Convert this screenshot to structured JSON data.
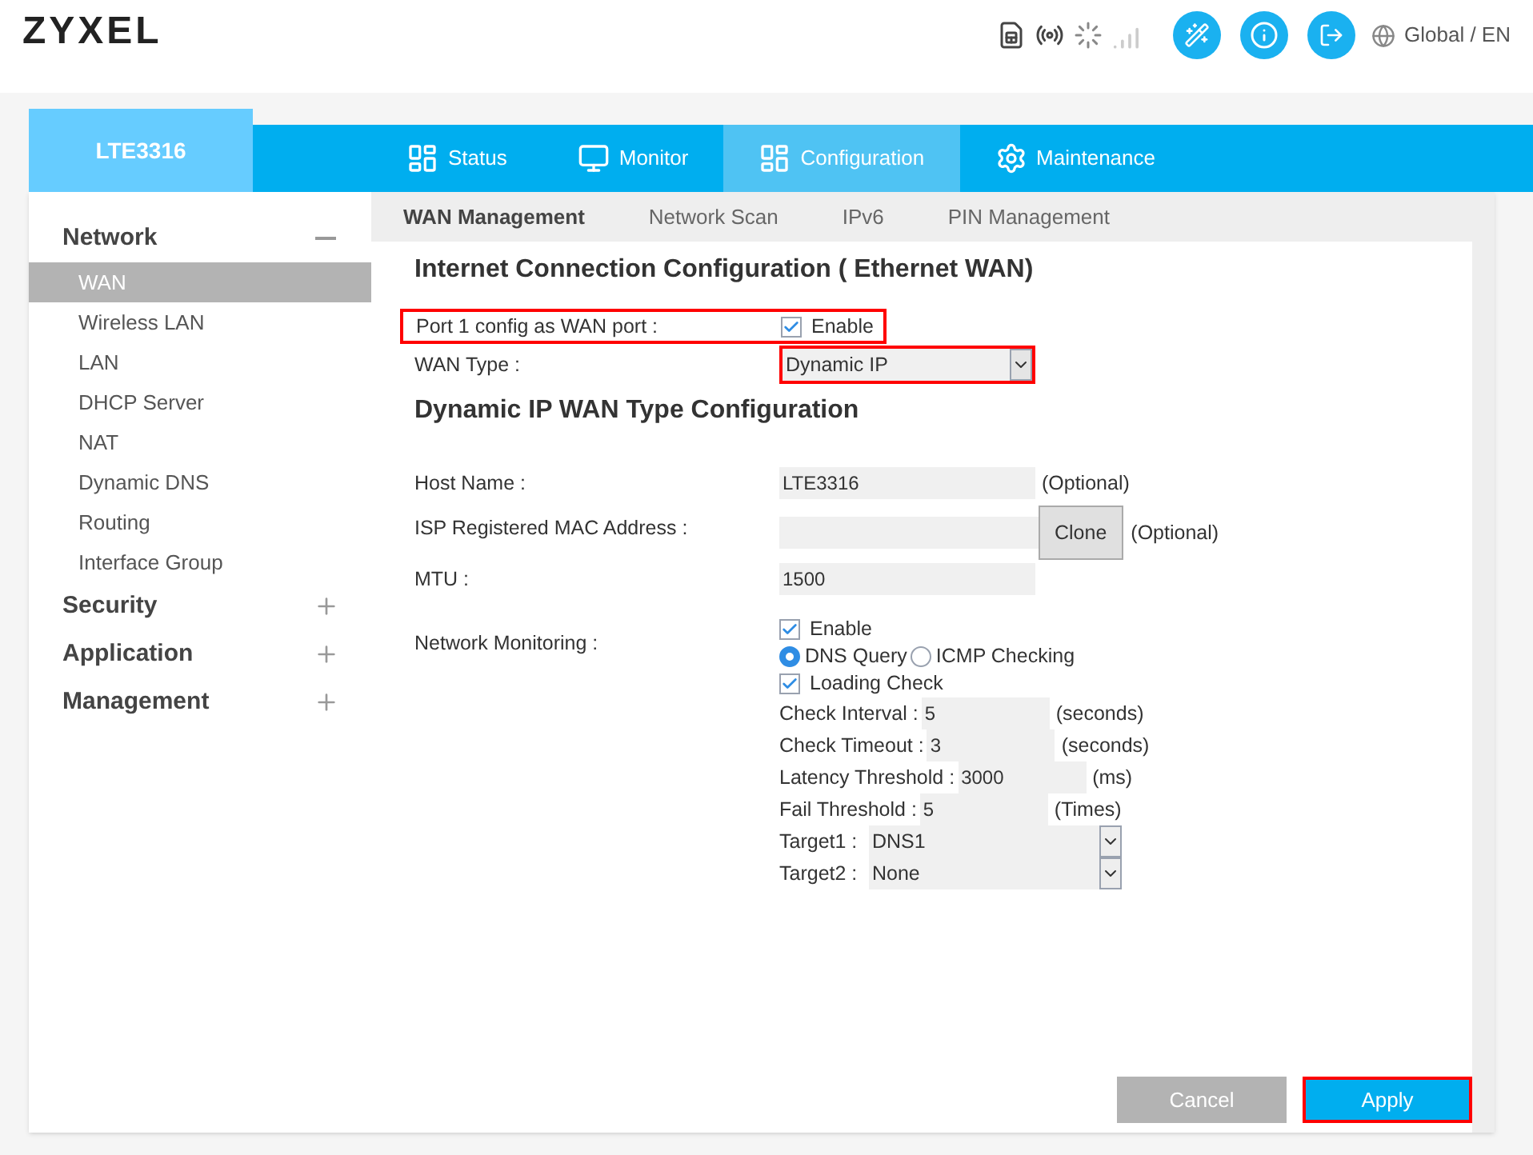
{
  "header": {
    "logo": "ZYXEL",
    "language": "Global / EN"
  },
  "device_tab": "LTE3316",
  "nav": [
    {
      "label": "Status",
      "selected": false
    },
    {
      "label": "Monitor",
      "selected": false
    },
    {
      "label": "Configuration",
      "selected": true
    },
    {
      "label": "Maintenance",
      "selected": false
    }
  ],
  "sidebar": [
    {
      "label": "Network",
      "expanded": true,
      "children": [
        {
          "label": "WAN",
          "selected": true
        },
        {
          "label": "Wireless LAN",
          "selected": false
        },
        {
          "label": "LAN",
          "selected": false
        },
        {
          "label": "DHCP Server",
          "selected": false
        },
        {
          "label": "NAT",
          "selected": false
        },
        {
          "label": "Dynamic DNS",
          "selected": false
        },
        {
          "label": "Routing",
          "selected": false
        },
        {
          "label": "Interface Group",
          "selected": false
        }
      ]
    },
    {
      "label": "Security",
      "expanded": false
    },
    {
      "label": "Application",
      "expanded": false
    },
    {
      "label": "Management",
      "expanded": false
    }
  ],
  "subtabs": [
    {
      "label": "WAN Management",
      "selected": true
    },
    {
      "label": "Network Scan",
      "selected": false
    },
    {
      "label": "IPv6",
      "selected": false
    },
    {
      "label": "PIN Management",
      "selected": false
    }
  ],
  "section1": {
    "title": "Internet Connection Configuration ( Ethernet WAN)",
    "port": {
      "label": "Port 1 config as WAN port :",
      "option": "Enable",
      "checked": true,
      "highlighted": true
    },
    "wan_type": {
      "label": "WAN Type :",
      "value": "Dynamic IP",
      "highlighted": true
    }
  },
  "section2": {
    "title": "Dynamic IP WAN Type Configuration",
    "host_name": {
      "label": "Host Name :",
      "value": "LTE3316",
      "note": "(Optional)"
    },
    "mac": {
      "label": "ISP Registered MAC Address :",
      "button": "Clone",
      "note": "(Optional)"
    },
    "mtu": {
      "label": "MTU :",
      "value": "1500"
    },
    "monitoring": {
      "label": "Network Monitoring :",
      "enable": {
        "label": "Enable",
        "checked": true
      },
      "methods": [
        {
          "label": "DNS Query",
          "selected": true
        },
        {
          "label": "ICMP Checking",
          "selected": false
        }
      ],
      "loading_check": {
        "label": "Loading Check",
        "checked": true
      },
      "fields": [
        {
          "label": "Check Interval :",
          "value": "5",
          "unit": "(seconds)"
        },
        {
          "label": "Check Timeout :",
          "value": "3",
          "unit": "(seconds)"
        },
        {
          "label": "Latency Threshold :",
          "value": "3000",
          "unit": "(ms)"
        },
        {
          "label": "Fail Threshold :",
          "value": "5",
          "unit": "(Times)"
        }
      ],
      "targets": [
        {
          "label": "Target1 :",
          "value": "DNS1"
        },
        {
          "label": "Target2 :",
          "value": "None"
        }
      ]
    }
  },
  "buttons": [
    {
      "label": "Cancel",
      "kind": "secondary",
      "highlighted": false
    },
    {
      "label": "Apply",
      "kind": "primary",
      "highlighted": true
    }
  ]
}
